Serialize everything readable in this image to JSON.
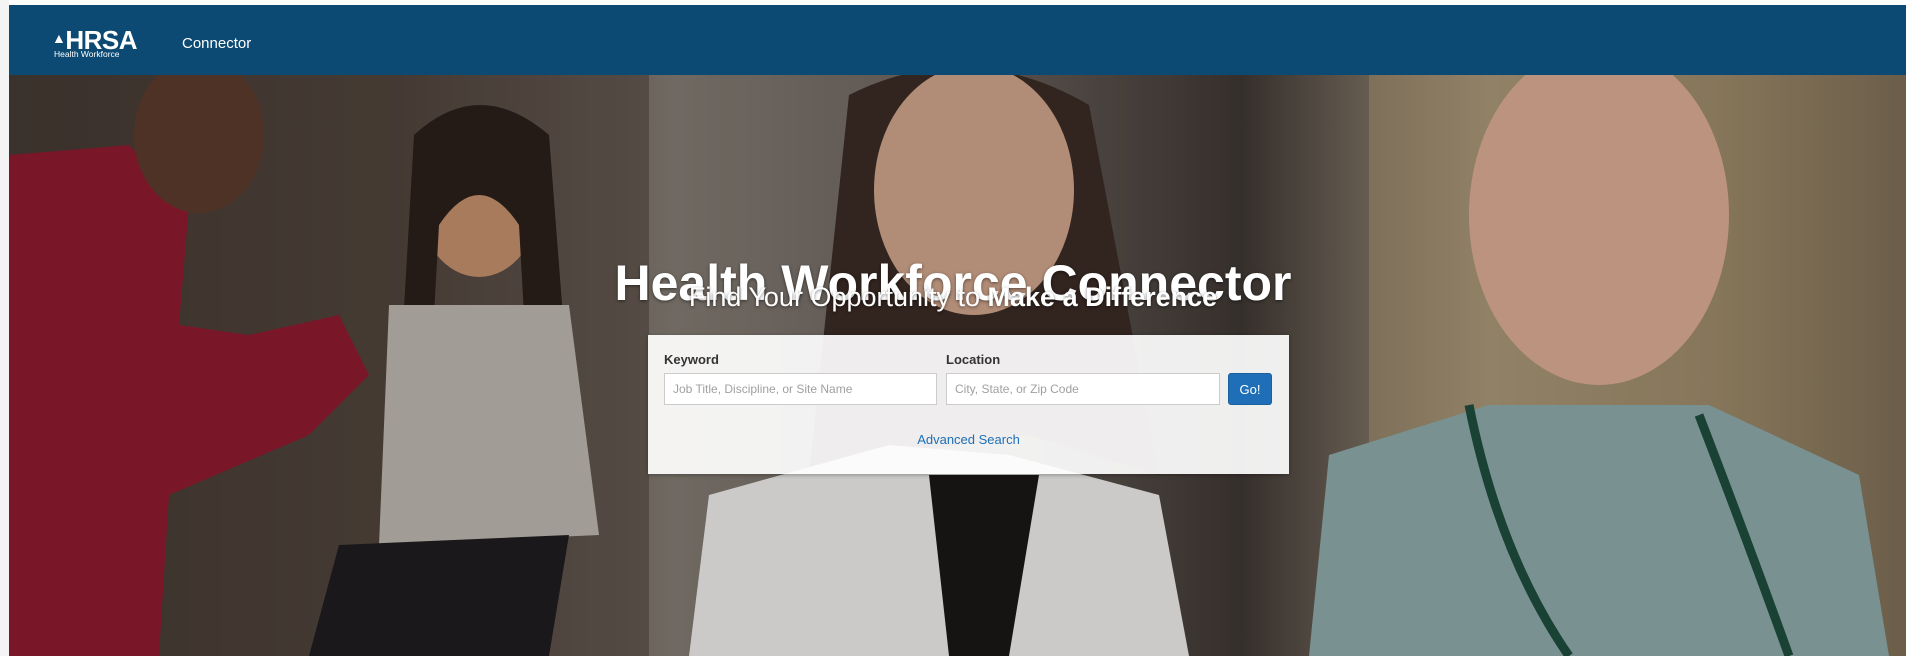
{
  "header": {
    "logo_mark": "HRSA",
    "logo_subtext": "Health Workforce",
    "app_name": "Connector",
    "background_color": "#0d4a73"
  },
  "hero": {
    "title_regular": "Health Workforce ",
    "title_bold": "Connector",
    "subtitle_regular": "Find Your Opportunity to ",
    "subtitle_bold": "Make a Difference",
    "photo_subjects": [
      "clinician-examining-child",
      "smiling-female-doctor",
      "smiling-male-nurse"
    ]
  },
  "search": {
    "keyword_label": "Keyword",
    "keyword_placeholder": "Job Title, Discipline, or Site Name",
    "keyword_value": "",
    "location_label": "Location",
    "location_placeholder": "City, State, or Zip Code",
    "location_value": "",
    "go_label": "Go!",
    "advanced_label": "Advanced Search",
    "accent_color": "#1e6fb8"
  }
}
